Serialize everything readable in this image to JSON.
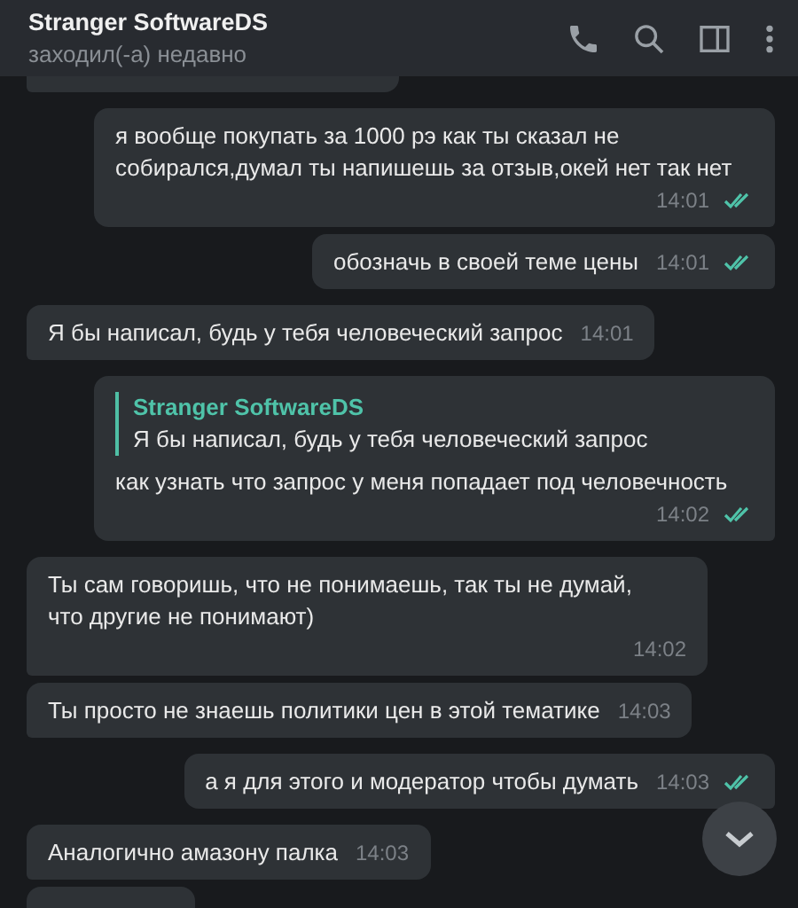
{
  "header": {
    "title": "Stranger SoftwareDS",
    "status": "заходил(-а) недавно"
  },
  "messages": [
    {
      "kind": "fragment",
      "outgoing": false
    },
    {
      "kind": "message",
      "outgoing": true,
      "text": "я вообще покупать за 1000 рэ как ты сказал не собирался,думал ты напишешь за отзыв,окей нет так нет",
      "time": "14:01",
      "read": true
    },
    {
      "kind": "message",
      "outgoing": true,
      "text": "обозначь в своей теме цены",
      "time": "14:01",
      "read": true
    },
    {
      "kind": "message",
      "outgoing": false,
      "text": "Я бы написал, будь у тебя человеческий запрос",
      "time": "14:01"
    },
    {
      "kind": "message",
      "outgoing": true,
      "reply": {
        "author": "Stranger SoftwareDS",
        "text": "Я бы написал, будь у тебя человеческий запрос"
      },
      "text": "как узнать что запрос у меня попадает под человечность",
      "time": "14:02",
      "read": true
    },
    {
      "kind": "message",
      "outgoing": false,
      "text": "Ты сам говоришь, что не понимаешь, так ты не думай, что другие не понимают)",
      "time": "14:02"
    },
    {
      "kind": "message",
      "outgoing": false,
      "text": "Ты просто не знаешь политики цен в этой тематике",
      "time": "14:03"
    },
    {
      "kind": "message",
      "outgoing": true,
      "text": "а я для этого и модератор чтобы думать",
      "time": "14:03",
      "read": true
    },
    {
      "kind": "message",
      "outgoing": false,
      "text": "Аналогично амазону палка",
      "time": "14:03"
    },
    {
      "kind": "fragment",
      "outgoing": false
    }
  ]
}
